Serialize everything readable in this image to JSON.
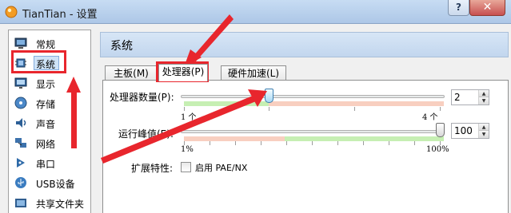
{
  "window": {
    "title": "TianTian - 设置",
    "help_label": "?",
    "close_label": "✕"
  },
  "sidebar": {
    "items": [
      {
        "label": "常规",
        "icon": "general-monitor-icon"
      },
      {
        "label": "系统",
        "icon": "system-chip-icon",
        "selected": true
      },
      {
        "label": "显示",
        "icon": "display-monitor-icon"
      },
      {
        "label": "存储",
        "icon": "storage-disc-icon"
      },
      {
        "label": "声音",
        "icon": "speaker-icon"
      },
      {
        "label": "网络",
        "icon": "network-icon"
      },
      {
        "label": "串口",
        "icon": "serial-port-icon"
      },
      {
        "label": "USB设备",
        "icon": "usb-icon"
      },
      {
        "label": "共享文件夹",
        "icon": "shared-folder-icon"
      }
    ]
  },
  "panel": {
    "title": "系统"
  },
  "tabs": [
    {
      "label": "主板(M)",
      "active": false
    },
    {
      "label": "处理器(P)",
      "active": true
    },
    {
      "label": "硬件加速(L)",
      "active": false
    }
  ],
  "processor": {
    "count_label": "处理器数量(P):",
    "count_value": "2",
    "count_min_label": "1 个",
    "count_max_label": "4 个",
    "count_min": 1,
    "count_max": 4,
    "exec_cap_label": "运行峰值(E):",
    "exec_cap_value": "100",
    "exec_cap_unit": "%",
    "exec_cap_min_label": "1%",
    "exec_cap_max_label": "100%",
    "extended_label": "扩展特性:",
    "pae_label": "启用 PAE/NX",
    "pae_checked": false
  },
  "annotation_colors": {
    "highlight": "#e8262d",
    "slider_green": "#c6efb3",
    "slider_red": "#f8cfc0",
    "header_blue": "#c9dbf0"
  }
}
